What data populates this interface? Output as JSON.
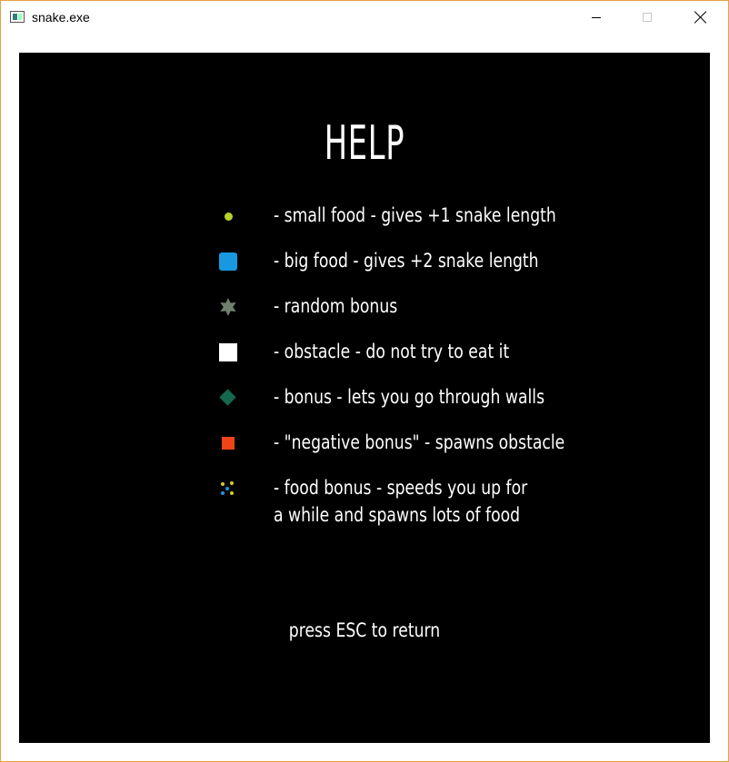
{
  "window": {
    "title": "snake.exe"
  },
  "help": {
    "title": "HELP",
    "items": [
      {
        "icon": "small-food-icon",
        "text": "-  small food - gives +1 snake length",
        "color": "#b5d32a"
      },
      {
        "icon": "big-food-icon",
        "text": "-  big food - gives +2 snake length",
        "color": "#1898df"
      },
      {
        "icon": "random-bonus-icon",
        "text": "-  random bonus",
        "color": "#6f7f6f"
      },
      {
        "icon": "obstacle-icon",
        "text": "-  obstacle - do not try to eat it",
        "color": "#ffffff"
      },
      {
        "icon": "wall-pass-bonus-icon",
        "text": "-  bonus - lets you go through walls",
        "color": "#14684e"
      },
      {
        "icon": "negative-bonus-icon",
        "text": "-  \"negative bonus\" - spawns obstacle",
        "color": "#ee4418"
      },
      {
        "icon": "food-bonus-icon",
        "text": "-  food bonus - speeds you up for",
        "text2": "a while and spawns lots of food",
        "color": "#d4d020"
      }
    ],
    "footer": "press ESC to return"
  }
}
